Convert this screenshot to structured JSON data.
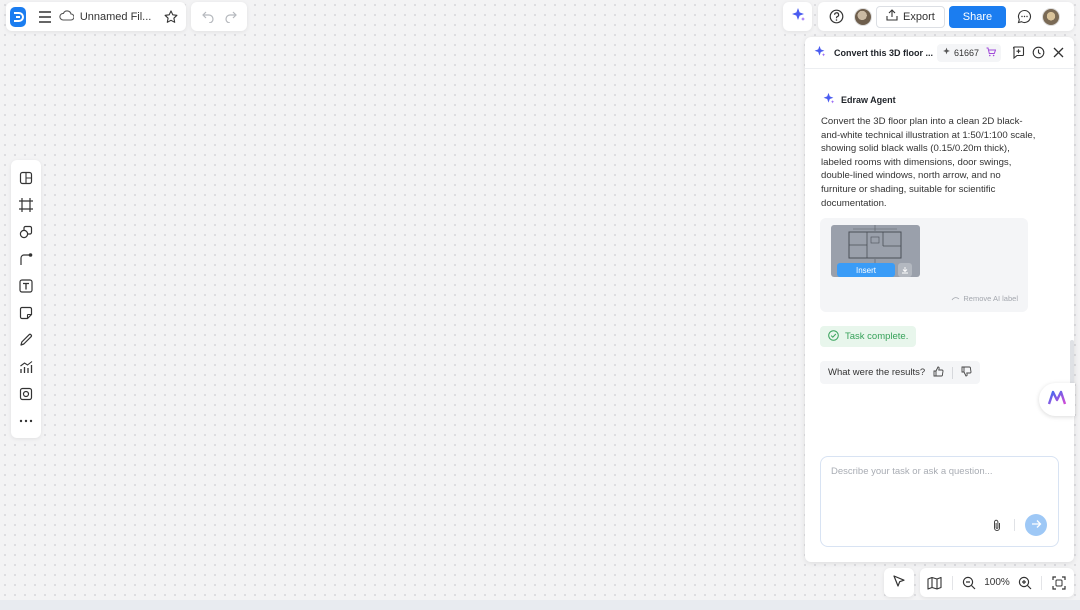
{
  "app": {
    "file_title": "Unnamed Fil..."
  },
  "toolbar": {
    "export_label": "Export",
    "share_label": "Share"
  },
  "left_tools": [
    {
      "name": "panel-toggle-icon"
    },
    {
      "name": "frame-icon"
    },
    {
      "name": "shapes-icon"
    },
    {
      "name": "connector-icon"
    },
    {
      "name": "text-icon"
    },
    {
      "name": "sticky-note-icon"
    },
    {
      "name": "pen-icon"
    },
    {
      "name": "chart-icon"
    },
    {
      "name": "media-icon"
    },
    {
      "name": "more-icon"
    }
  ],
  "panel": {
    "title": "Convert this 3D floor ...",
    "credits": "61667",
    "agent_name": "Edraw Agent",
    "message": "Convert the 3D floor plan into a clean 2D black-and-white technical illustration at 1:50/1:100 scale, showing solid black walls (0.15/0.20m thick), labeled rooms with dimensions, door swings, double-lined windows, north arrow, and no furniture or shading, suitable for scientific documentation.",
    "insert_label": "Insert",
    "remove_label": "Remove AI label",
    "task_status": "Task complete.",
    "followup": "What were the results?",
    "input_placeholder": "Describe your task or ask a question..."
  },
  "zoom": {
    "level": "100%"
  },
  "colors": {
    "accent": "#1b7df0",
    "success": "#37a25a",
    "canvas": "#f3f3f4"
  }
}
